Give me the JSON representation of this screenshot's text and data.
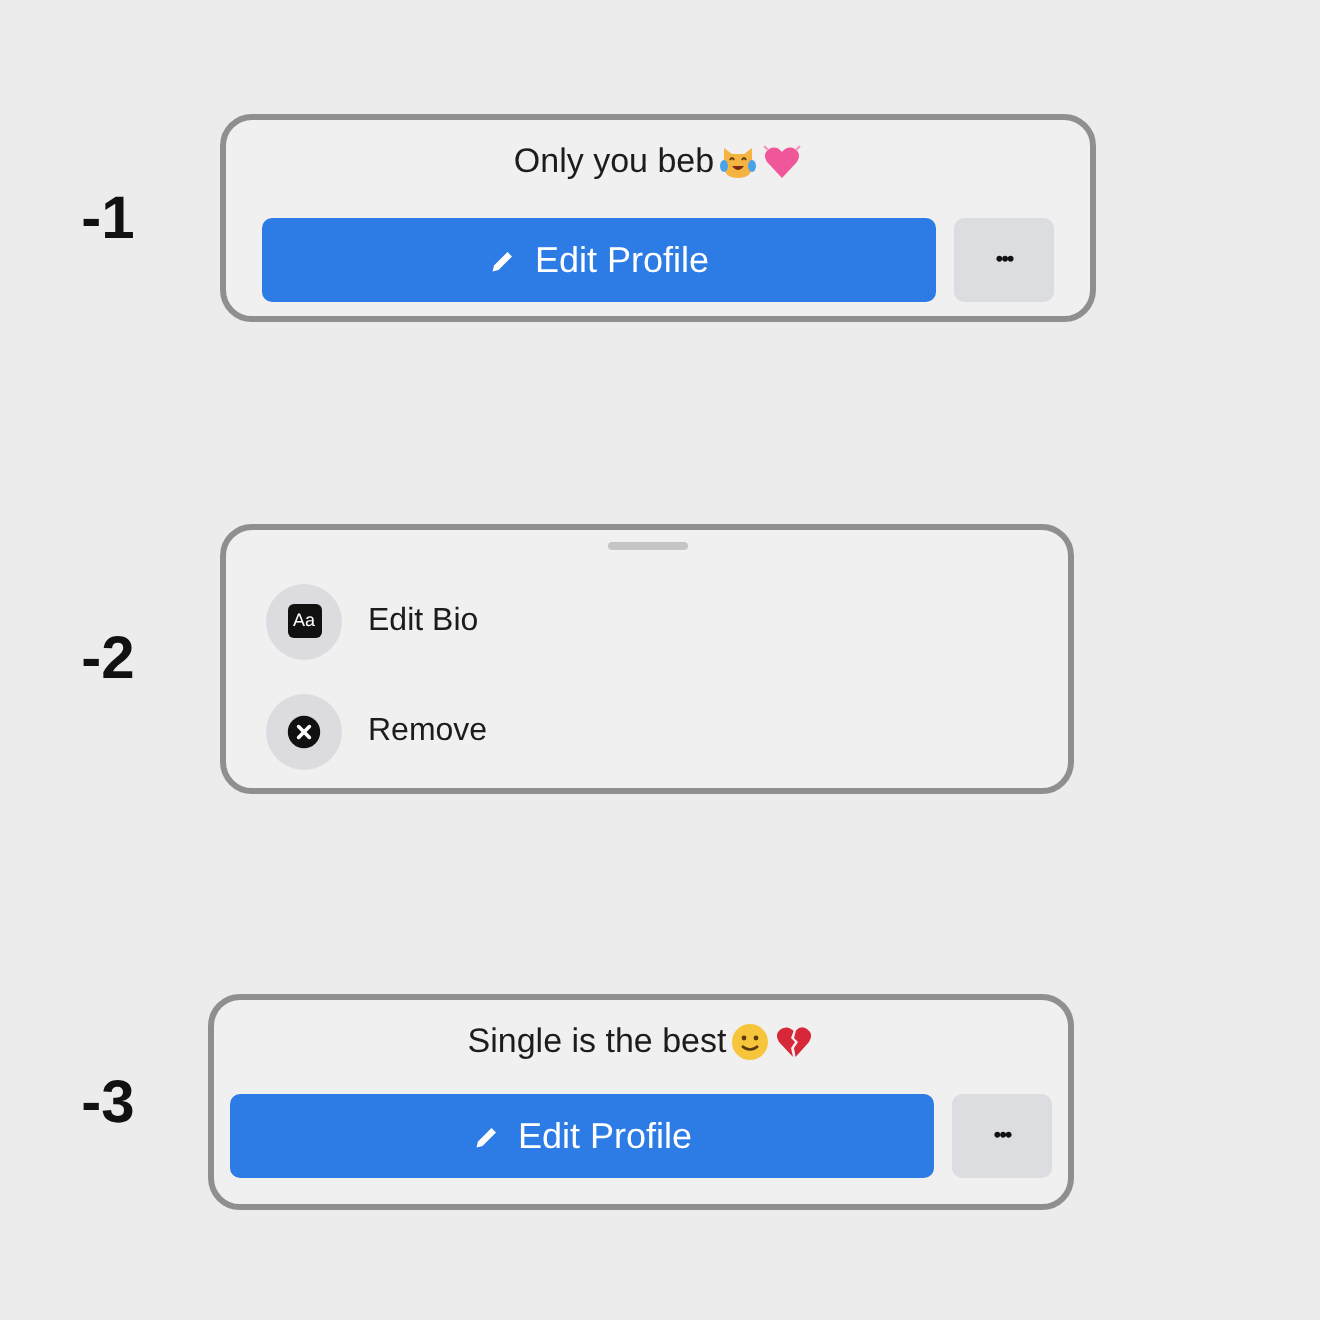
{
  "sections": [
    {
      "number": "-1",
      "kind": "profile",
      "bio": "Only you beb",
      "button": "Edit Profile",
      "more": "•••"
    },
    {
      "number": "-2",
      "kind": "menu",
      "items": [
        {
          "badge": "Aa",
          "label": "Edit Bio"
        },
        {
          "label": "Remove"
        }
      ]
    },
    {
      "number": "-3",
      "kind": "profile",
      "bio": "Single is the best",
      "button": "Edit Profile",
      "more": "•••"
    }
  ]
}
